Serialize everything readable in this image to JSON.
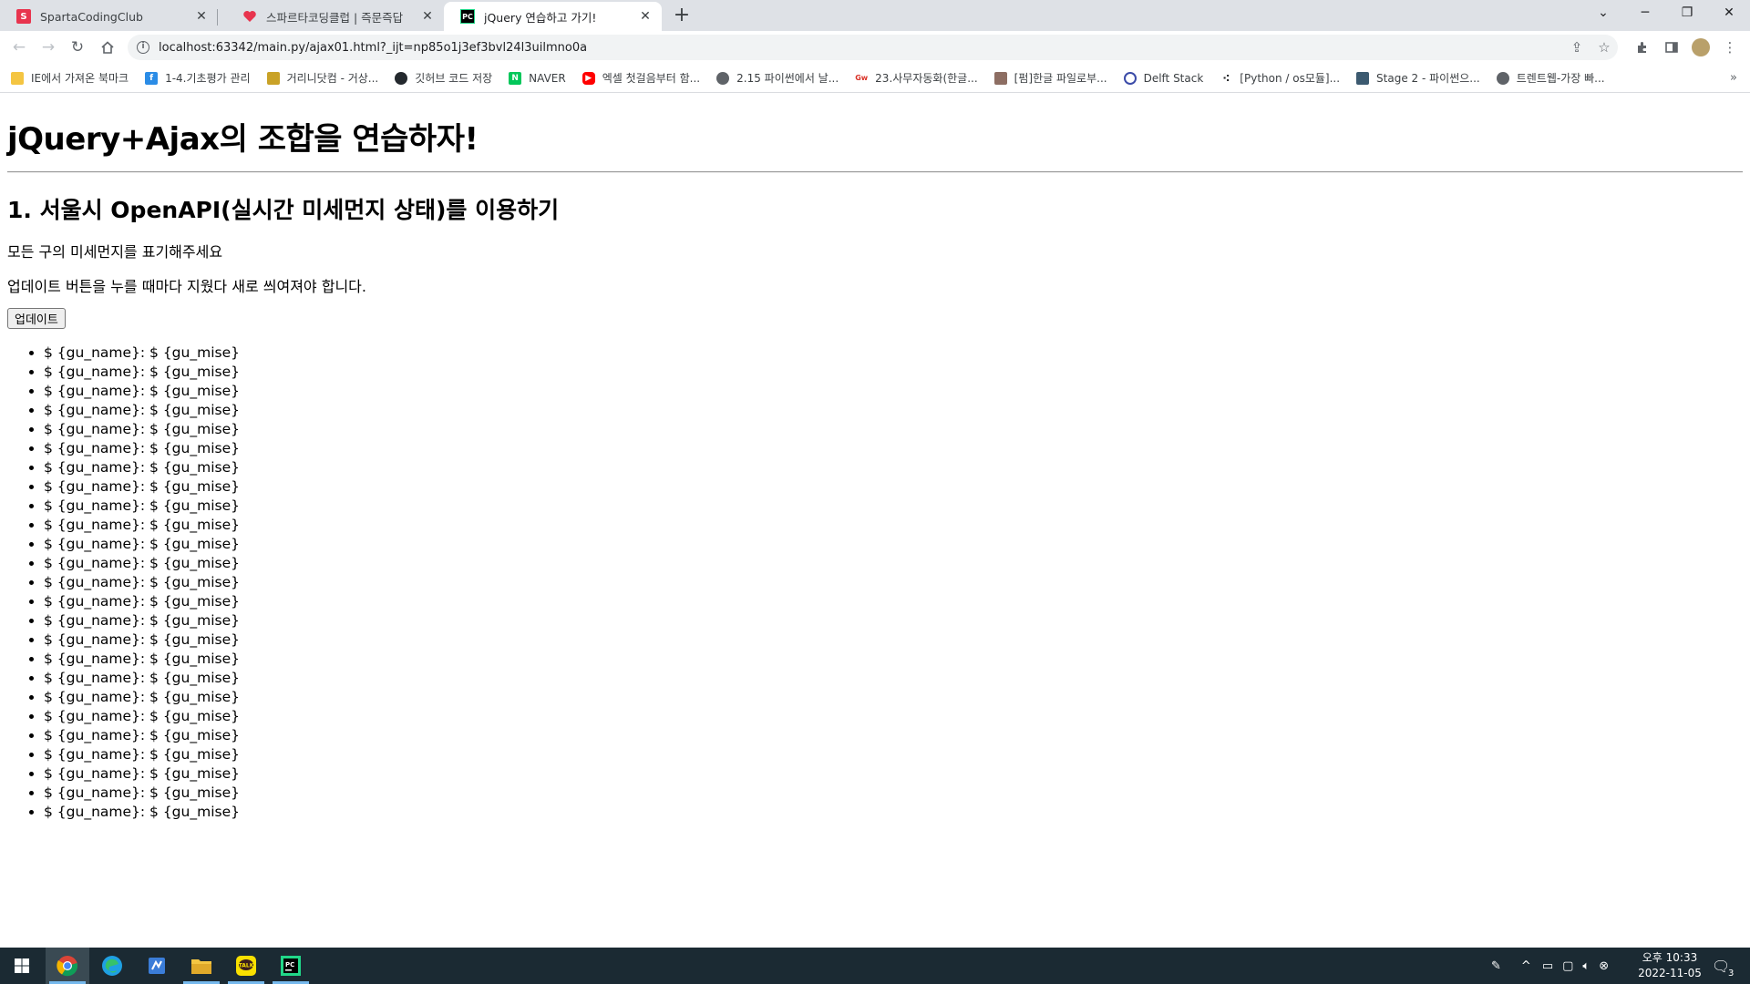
{
  "browser": {
    "tabs": [
      {
        "title": "SpartaCodingClub",
        "icon": "sparta-favicon",
        "active": false
      },
      {
        "title": "스파르타코딩클럽 | 즉문즉답",
        "icon": "heart-favicon",
        "active": false
      },
      {
        "title": "jQuery 연습하고 가기!",
        "icon": "pycharm-favicon",
        "active": true
      }
    ],
    "new_tab_label": "+",
    "url": "localhost:63342/main.py/ajax01.html?_ijt=np85o1j3ef3bvl24l3uilmno0a",
    "bookmarks": [
      {
        "label": "IE에서 가져온 북마크",
        "icon": "folder-icon",
        "color": "#f4c542"
      },
      {
        "label": "1-4.기초평가 관리",
        "icon": "f-icon",
        "color": "#2b8ce6"
      },
      {
        "label": "거리니닷컴 - 거상...",
        "icon": "bird-icon",
        "color": "#c9a227"
      },
      {
        "label": "깃허브 코드 저장",
        "icon": "github-icon",
        "color": "#24292e"
      },
      {
        "label": "NAVER",
        "icon": "naver-icon",
        "color": "#03c75a"
      },
      {
        "label": "엑셀 첫걸음부터 함...",
        "icon": "youtube-icon",
        "color": "#ff0000"
      },
      {
        "label": "2.15 파이썬에서 날...",
        "icon": "globe-icon",
        "color": "#5f6368"
      },
      {
        "label": "23.사무자동화(한글...",
        "icon": "gw-icon",
        "color": "#d93025"
      },
      {
        "label": "[펌]한글 파일로부...",
        "icon": "person-icon",
        "color": "#8d6e63"
      },
      {
        "label": "Delft Stack",
        "icon": "delft-icon",
        "color": "#3b4ba8"
      },
      {
        "label": "[Python / os모듈]...",
        "icon": "dots-icon",
        "color": "#202124"
      },
      {
        "label": "Stage 2 - 파이썬으...",
        "icon": "stage-icon",
        "color": "#3c5a70"
      },
      {
        "label": "트렌트웹-가장 빠...",
        "icon": "globe-icon",
        "color": "#5f6368"
      }
    ]
  },
  "page": {
    "title": "jQuery+Ajax의 조합을 연습하자!",
    "section_heading": "1. 서울시 OpenAPI(실시간 미세먼지 상태)를 이용하기",
    "instruction_1": "모든 구의 미세먼지를 표기해주세요",
    "instruction_2": "업데이트 버튼을 누를 때마다 지웠다 새로 씌여져야 합니다.",
    "update_button": "업데이트",
    "items": [
      "$ {gu_name}: $ {gu_mise}",
      "$ {gu_name}: $ {gu_mise}",
      "$ {gu_name}: $ {gu_mise}",
      "$ {gu_name}: $ {gu_mise}",
      "$ {gu_name}: $ {gu_mise}",
      "$ {gu_name}: $ {gu_mise}",
      "$ {gu_name}: $ {gu_mise}",
      "$ {gu_name}: $ {gu_mise}",
      "$ {gu_name}: $ {gu_mise}",
      "$ {gu_name}: $ {gu_mise}",
      "$ {gu_name}: $ {gu_mise}",
      "$ {gu_name}: $ {gu_mise}",
      "$ {gu_name}: $ {gu_mise}",
      "$ {gu_name}: $ {gu_mise}",
      "$ {gu_name}: $ {gu_mise}",
      "$ {gu_name}: $ {gu_mise}",
      "$ {gu_name}: $ {gu_mise}",
      "$ {gu_name}: $ {gu_mise}",
      "$ {gu_name}: $ {gu_mise}",
      "$ {gu_name}: $ {gu_mise}",
      "$ {gu_name}: $ {gu_mise}",
      "$ {gu_name}: $ {gu_mise}",
      "$ {gu_name}: $ {gu_mise}",
      "$ {gu_name}: $ {gu_mise}",
      "$ {gu_name}: $ {gu_mise}"
    ]
  },
  "taskbar": {
    "apps": [
      {
        "name": "chrome-app",
        "color": "#4285f4"
      },
      {
        "name": "edge-app",
        "color": "#1fa0e3"
      },
      {
        "name": "excel-app",
        "color": "#3b7dd8"
      },
      {
        "name": "file-explorer-app",
        "color": "#f4c542"
      },
      {
        "name": "kakaotalk-app",
        "color": "#f9e000"
      },
      {
        "name": "pycharm-app",
        "color": "#21d789"
      }
    ],
    "clock_time": "오후 10:33",
    "clock_date": "2022-11-05",
    "notification_count": "3"
  }
}
